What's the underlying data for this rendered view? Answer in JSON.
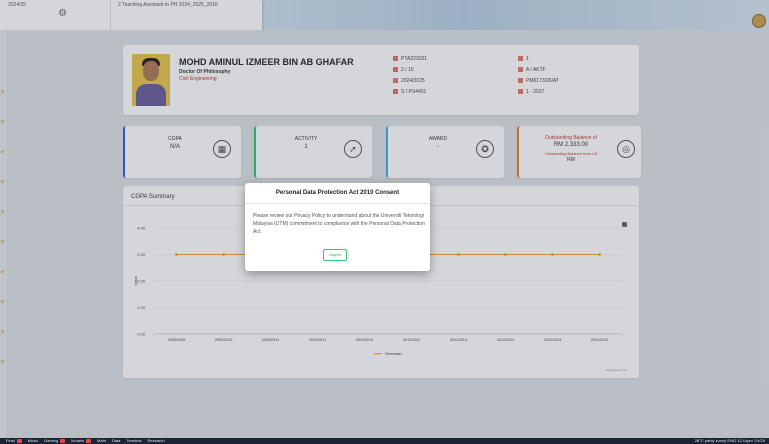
{
  "student": {
    "name": "MOHD AMINUL IZMEER BIN AB GHAFAR",
    "degree": "Doctor Of Philosophy",
    "faculty": "Civil Engineering",
    "info_left": [
      "PTA223021",
      "2 / 10",
      "2024/2025",
      "S / PS4401"
    ],
    "info_right": [
      "1",
      "A / AKTF",
      "PM0173/26/AT",
      "1 - 2037"
    ]
  },
  "stats": {
    "cgpa_label": "CGPA",
    "cgpa_value": "N/A",
    "activity_label": "ACTIVITY",
    "activity_value": "1",
    "award_label": "AWARD",
    "award_value": "-",
    "balance_label": "Outstanding Balance of",
    "balance_value": "RM 2,333.00",
    "balance_label2": "Outstanding Balance from LB",
    "balance_value2": "RM"
  },
  "chart_card": {
    "title": "CGPA Summary",
    "credit": "Highcharts.com"
  },
  "chart_data": {
    "type": "line",
    "categories": [
      "20082009",
      "20092010",
      "20092011",
      "20102011",
      "20102012",
      "20112012",
      "20112013",
      "20122013",
      "20122013",
      "20122013"
    ],
    "series": [
      {
        "name": "Semester",
        "values": [
          3.0,
          3.0,
          3.0,
          3.0,
          3.0,
          3.0,
          3.0,
          3.0,
          3.0,
          3.0
        ]
      }
    ],
    "yticks": [
      "4.00",
      "3.00",
      "2.00",
      "1.00",
      "0.00"
    ],
    "ylabel": "Value",
    "ylim": [
      0,
      4
    ],
    "series_color": "#f0a030"
  },
  "modal": {
    "title": "Personal Data Protection Act 2010 Consent",
    "body": "Please review our Privacy Policy to understand about the Universiti Teknologi Malaysia (UTM) commitment to compliance with the Personal Data Protection Act.",
    "button": "I Agree"
  },
  "topbar": {
    "snip_left": "2024/25",
    "snip_right": "2 Teaching Assistant to PH 2024_2025_2016"
  },
  "taskbar": {
    "items": [
      "Final",
      "Music",
      "Gaming",
      "Models",
      "Math",
      "Data",
      "Terminal",
      "Research"
    ],
    "right": "28°C partly sunny    ENG    12:14pm   7/4/25"
  }
}
